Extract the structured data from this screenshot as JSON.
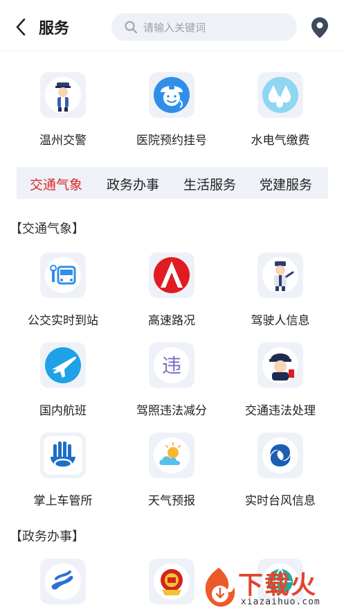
{
  "header": {
    "title": "服务",
    "search_placeholder": "请输入关键词"
  },
  "top_services": [
    {
      "label": "温州交警",
      "icon": "traffic-police-icon"
    },
    {
      "label": "医院预约挂号",
      "icon": "nurse-icon"
    },
    {
      "label": "水电气缴费",
      "icon": "water-drops-icon"
    }
  ],
  "tabs": [
    {
      "label": "交通气象",
      "active": true
    },
    {
      "label": "政务办事",
      "active": false
    },
    {
      "label": "生活服务",
      "active": false
    },
    {
      "label": "党建服务",
      "active": false
    }
  ],
  "sections": [
    {
      "title": "【交通气象】",
      "items": [
        {
          "label": "公交实时到站",
          "icon": "bus-icon"
        },
        {
          "label": "高速路况",
          "icon": "highway-logo-icon"
        },
        {
          "label": "驾驶人信息",
          "icon": "police-officer-icon"
        },
        {
          "label": "国内航班",
          "icon": "airplane-icon"
        },
        {
          "label": "驾照违法减分",
          "icon": "violation-character-icon"
        },
        {
          "label": "交通违法处理",
          "icon": "police-cartoon-icon"
        },
        {
          "label": "掌上车管所",
          "icon": "hand-car-icon"
        },
        {
          "label": "天气预报",
          "icon": "sun-cloud-icon"
        },
        {
          "label": "实时台风信息",
          "icon": "typhoon-icon"
        }
      ]
    },
    {
      "title": "【政务办事】",
      "items": [
        {
          "label": "",
          "icon": "running-figure-icon"
        },
        {
          "label": "",
          "icon": "national-emblem-icon"
        },
        {
          "label": "",
          "icon": "globe-icon"
        }
      ]
    }
  ],
  "watermark": {
    "text": "下载火",
    "url": "xiazaihuo.com"
  },
  "colors": {
    "accent_red": "#d9262b",
    "tile_bg": "#eef2f8",
    "blue": "#2f8fe8"
  }
}
